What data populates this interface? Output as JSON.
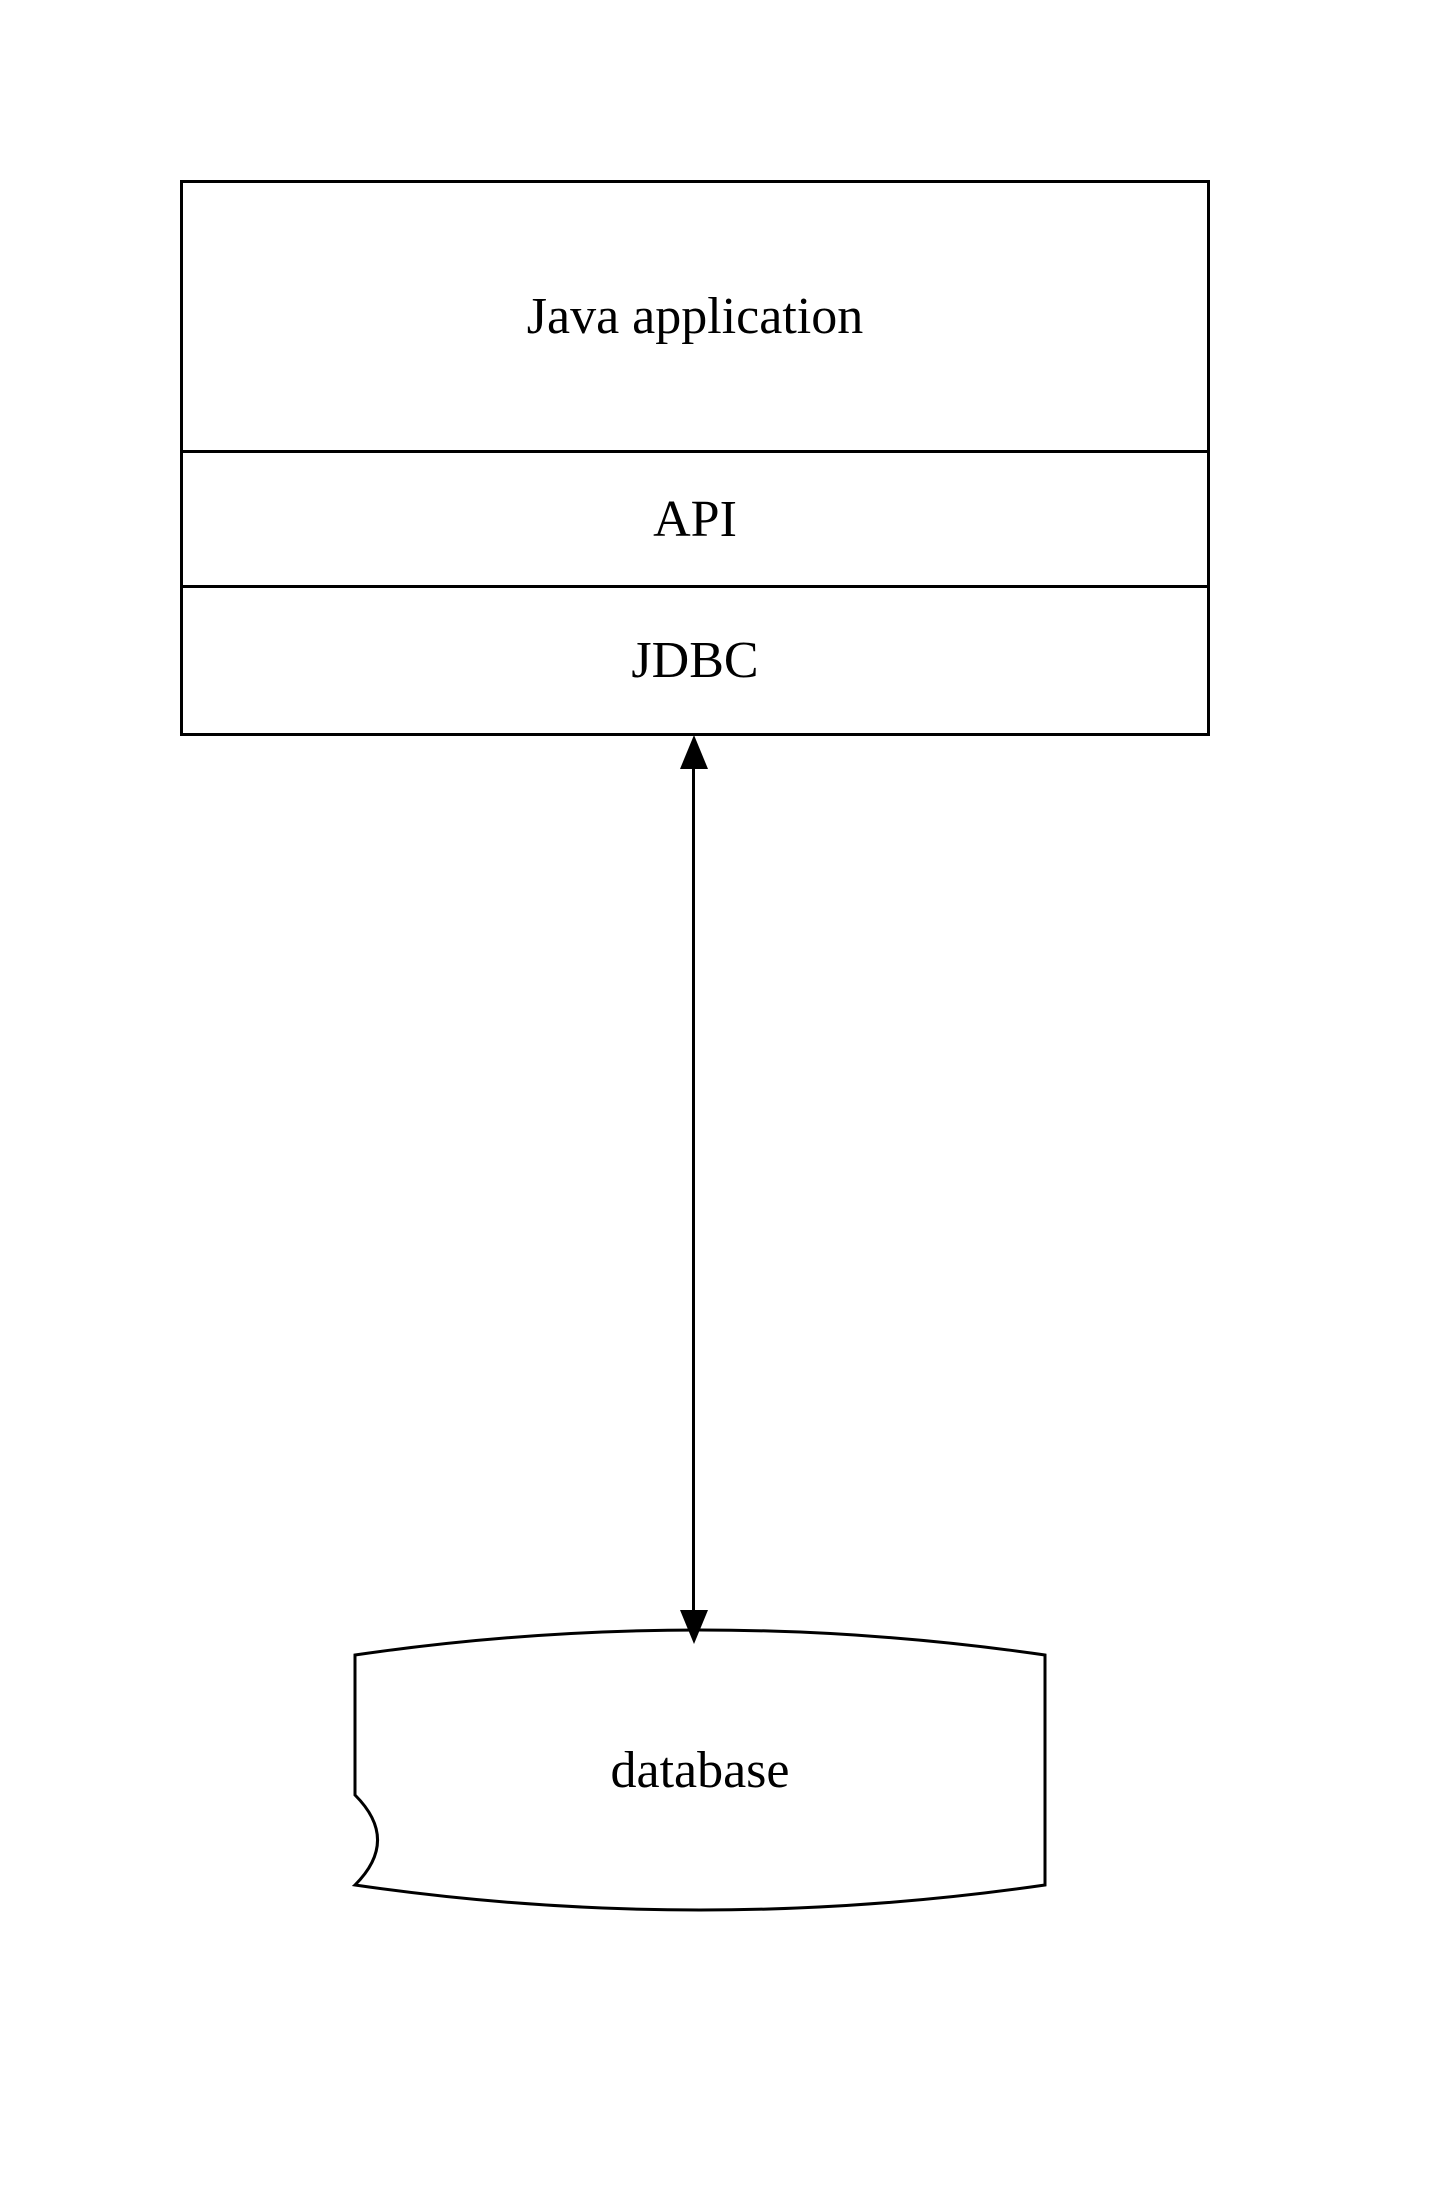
{
  "diagram": {
    "layers": {
      "app": "Java application",
      "api": "API",
      "jdbc": "JDBC"
    },
    "database": "database"
  }
}
